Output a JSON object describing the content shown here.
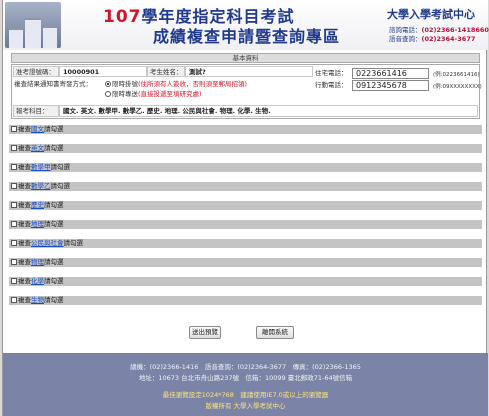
{
  "header": {
    "year": "107",
    "title_line1": "學年度指定科目考試",
    "title_line2": "成績複查申請暨查詢專區",
    "org_name": "大學入學考試中心",
    "phone_label_1": "諮詢電話：",
    "phone_value_1": "(02)2366-14186608",
    "phone_label_2": "語音查詢：",
    "phone_value_2": "(02)2364-3677"
  },
  "basic_info": {
    "section_title": "基本資料",
    "exam_no_label": "准考證號碼：",
    "exam_no": "10000901",
    "name_label": "考生姓名：",
    "name": "測試?",
    "home_phone_label": "住宅電話：",
    "home_phone": "0223661416",
    "home_phone_hint": "(例:0223661416)",
    "mobile_label": "行動電話：",
    "mobile": "0912345678",
    "mobile_hint": "(例:09XXXXXXXX)",
    "notify_label": "複查結果通知書寄發方式：",
    "option1_label": "限時掛號",
    "option1_note": "(住所須有人簽收，否則須至郵局招領)",
    "option1_selected": true,
    "option2_label": "限時專送",
    "option2_note": "(直接投遞至填研究處)",
    "option2_selected": false,
    "subjects_label": "報考科目：",
    "subjects_list": "國文. 英文. 數學甲. 數學乙. 歷史. 地理. 公民與社會. 物理. 化學. 生物."
  },
  "subjects": [
    {
      "prefix": "複查",
      "name": "國文",
      "suffix": "請勾選"
    },
    {
      "prefix": "複查",
      "name": "英文",
      "suffix": "請勾選"
    },
    {
      "prefix": "複查",
      "name": "數學甲",
      "suffix": "請勾選"
    },
    {
      "prefix": "複查",
      "name": "數學乙",
      "suffix": "請勾選"
    },
    {
      "prefix": "複查",
      "name": "歷史",
      "suffix": "請勾選"
    },
    {
      "prefix": "複查",
      "name": "地理",
      "suffix": "請勾選"
    },
    {
      "prefix": "複查",
      "name": "公民與社會",
      "suffix": "請勾選"
    },
    {
      "prefix": "複查",
      "name": "物理",
      "suffix": "請勾選"
    },
    {
      "prefix": "複查",
      "name": "化學",
      "suffix": "請勾選"
    },
    {
      "prefix": "複查",
      "name": "生物",
      "suffix": "請勾選"
    }
  ],
  "actions": {
    "submit_label": "送出預覽",
    "exit_label": "離開系統"
  },
  "footer": {
    "line1": "總機：(02)2366-1416　語音查詢：(02)2364-3677　傳真：(02)2366-1365",
    "line2": "地址：10673 台北市舟山路237號　信箱：10099 臺北郵政71-64號信箱",
    "line3": "最佳瀏覽設定1024*768　建議使用IE7.0或以上的瀏覽器",
    "line4": "版權所有 大學入學考試中心"
  },
  "colors": {
    "title_blue": "#1f3a8c",
    "year_red": "#d3142a",
    "row_gray": "#c4c4c4",
    "footer_bg": "#7b84a6",
    "link_blue": "#1a4fc4"
  }
}
